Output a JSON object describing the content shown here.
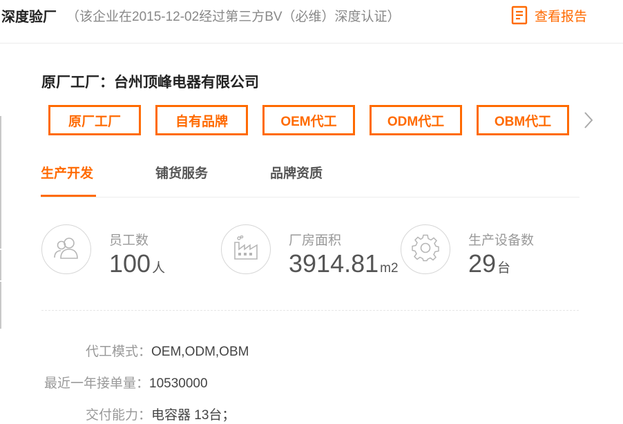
{
  "header": {
    "title": "深度验厂",
    "note": "（该企业在2015-12-02经过第三方BV（必维）深度认证）",
    "report_link": "查看报告",
    "report_icon": "report-icon"
  },
  "factory": {
    "name": "原厂工厂：台州顶峰电器有限公司"
  },
  "factory_types": [
    "原厂工厂",
    "自有品牌",
    "OEM代工",
    "ODM代工",
    "OBM代工"
  ],
  "tabs": [
    {
      "label": "生产开发",
      "active": true
    },
    {
      "label": "铺货服务",
      "active": false
    },
    {
      "label": "品牌资质",
      "active": false
    }
  ],
  "stats": [
    {
      "icon": "people-icon",
      "label": "员工数",
      "value": "100",
      "unit": "人"
    },
    {
      "icon": "factory-icon",
      "label": "厂房面积",
      "value": "3914.81",
      "unit": "m2"
    },
    {
      "icon": "gear-icon",
      "label": "生产设备数",
      "value": "29",
      "unit": "台"
    }
  ],
  "details": [
    {
      "label": "代工模式：",
      "value": "OEM,ODM,OBM"
    },
    {
      "label": "最近一年接单量：",
      "value": "10530000"
    },
    {
      "label": "交付能力：",
      "value": "电容器 13台；"
    }
  ],
  "colors": {
    "accent": "#ff6a00",
    "muted": "#999999",
    "border": "#ececec"
  }
}
